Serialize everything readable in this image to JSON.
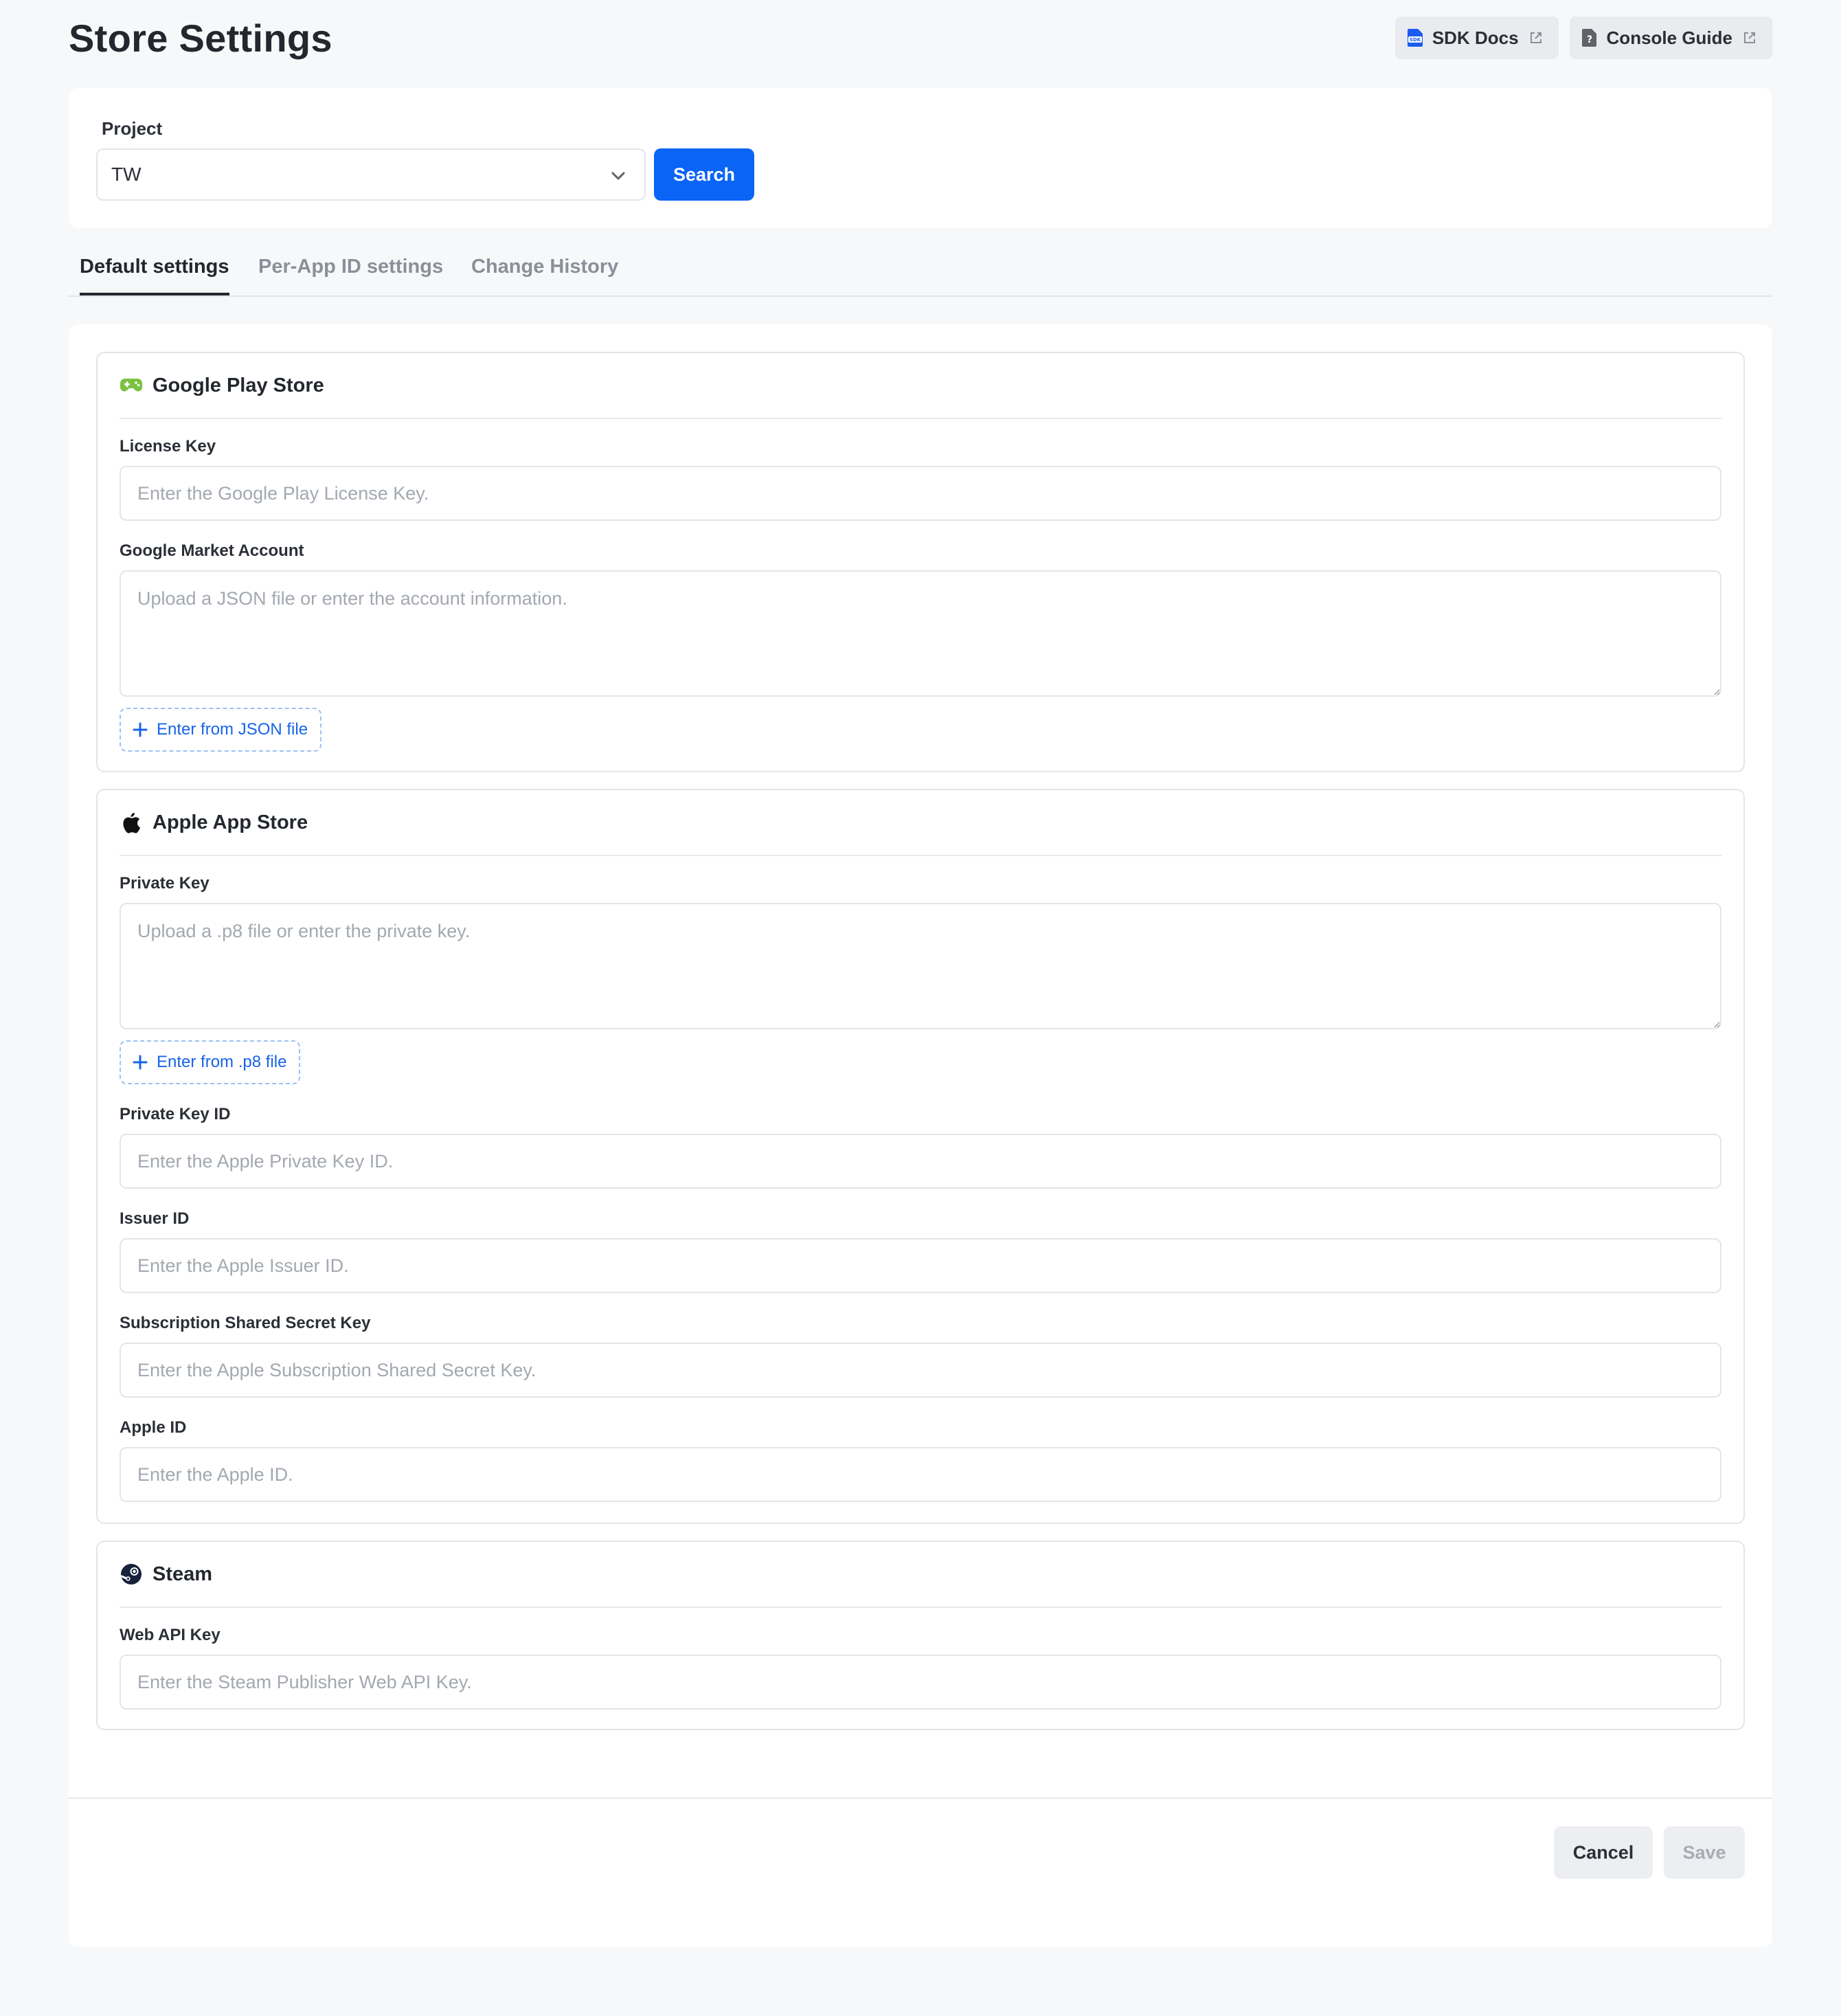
{
  "header": {
    "title": "Store Settings",
    "sdk_docs": "SDK Docs",
    "console_guide": "Console Guide"
  },
  "project": {
    "label": "Project",
    "selected": "TW",
    "search_label": "Search"
  },
  "tabs": [
    {
      "label": "Default settings",
      "active": true
    },
    {
      "label": "Per-App ID settings",
      "active": false
    },
    {
      "label": "Change History",
      "active": false
    }
  ],
  "google": {
    "title": "Google Play Store",
    "license_key_label": "License Key",
    "license_key_placeholder": "Enter the Google Play License Key.",
    "market_account_label": "Google Market Account",
    "market_account_placeholder": "Upload a JSON file or enter the account information.",
    "json_button": "Enter from JSON file"
  },
  "apple": {
    "title": "Apple App Store",
    "private_key_label": "Private Key",
    "private_key_placeholder": "Upload a .p8 file or enter the private key.",
    "p8_button": "Enter from .p8 file",
    "private_key_id_label": "Private Key ID",
    "private_key_id_placeholder": "Enter the Apple Private Key ID.",
    "issuer_id_label": "Issuer ID",
    "issuer_id_placeholder": "Enter the Apple Issuer ID.",
    "shared_secret_label": "Subscription Shared Secret Key",
    "shared_secret_placeholder": "Enter the Apple Subscription Shared Secret Key.",
    "apple_id_label": "Apple ID",
    "apple_id_placeholder": "Enter the Apple ID."
  },
  "steam": {
    "title": "Steam",
    "web_api_key_label": "Web API Key",
    "web_api_key_placeholder": "Enter the Steam Publisher Web API Key."
  },
  "footer": {
    "cancel": "Cancel",
    "save": "Save"
  },
  "colors": {
    "primary": "#0a64f5",
    "background": "#f7f8fa",
    "google_icon": "#7cc242",
    "sdk_icon": "#1a5cf0"
  }
}
